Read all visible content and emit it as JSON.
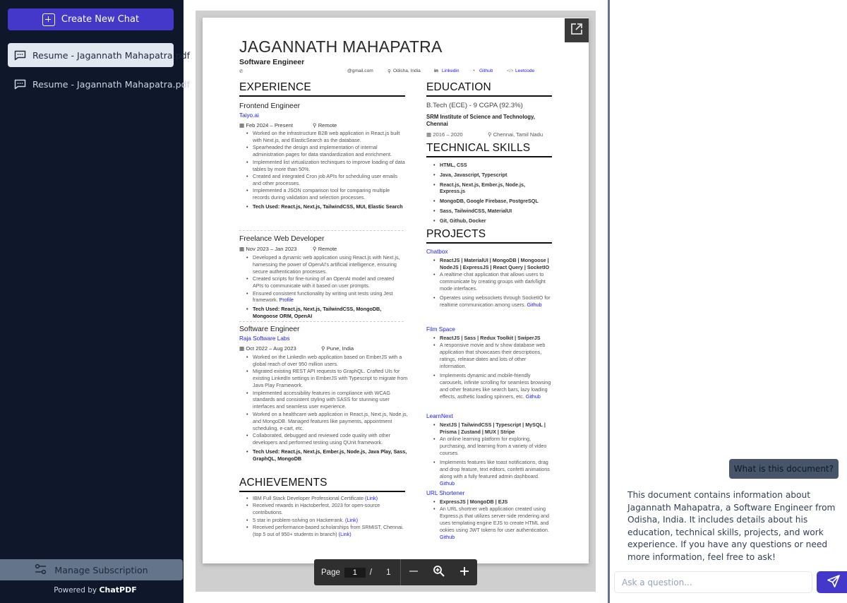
{
  "sidebar": {
    "create_new_chat": "Create New Chat",
    "chats": [
      {
        "label": "Resume - Jagannath Mahapatra.pdf",
        "active": true
      },
      {
        "label": "Resume - Jagannath Mahapatra.pdf",
        "active": false
      }
    ],
    "manage_subscription": "Manage Subscription",
    "powered_prefix": "Powered by",
    "powered_brand": "ChatPDF"
  },
  "colors": {
    "sidebar_bg": "#0f172a",
    "accent": "#4338ca",
    "active_item": "#e2e8f0",
    "slate": "#64748b",
    "link_blue": "#1a1aff"
  },
  "viewer": {
    "toolbar": {
      "page_label": "Page",
      "current_page": "1",
      "separator": "/",
      "total_pages": "1"
    }
  },
  "resume": {
    "name": "JAGANNATH MAHAPATRA",
    "title": "Software Engineer",
    "contact": {
      "phone_icon": "phone-icon",
      "email": "@gmail.com",
      "location": "Odisha, India",
      "linkedin": "Linkedin",
      "github": "Github",
      "leetcode": "Leetcode"
    },
    "sections": {
      "experience": "EXPERIENCE",
      "education": "EDUCATION",
      "skills": "TECHNICAL SKILLS",
      "projects": "PROJECTS",
      "achievements": "ACHIEVEMENTS"
    },
    "experience": [
      {
        "role": "Frontend Engineer",
        "company": "Taiyo.ai",
        "dates": "Feb 2024 – Present",
        "location": "Remote",
        "bullets": [
          "Worked on the infrastructure B2B web application in React.js built with Next.js, and ElasticSearch as the database.",
          "Spearheaded the design and implementation of internal administration pages for data standardization and enrichment.",
          "Implemented list virtualization techinques to improve loading of data tables by more than 50%.",
          "Created and integrated Cron job APIs for scheduling user emails and other processes.",
          "Implemented a JSON comparison tool for comparing multiple records during validation and selection processes."
        ],
        "tech": "Tech Used: React.js, Next.js, TailwindCSS, MUI, Elastic Search"
      },
      {
        "role": "Freelance Web Developer",
        "company": "",
        "dates": "Nov 2023 – Jan 2023",
        "location": "Remote",
        "bullets": [
          "Developed a dynamic web application using React.js with Next.js, harnessing the power of OpenAI's artificial intelligence, ensuring secure authentication processes.",
          "Created scripts for fine-tuning of an OpenAI model and created APIs to communicate with it based on user prompts.",
          "Ensured consistent functionality by writing unit tests using Jest framework."
        ],
        "bullet_link": "Profile",
        "tech": "Tech Used: React.js, Next.js, TailwindCSS, MongoDB, Mongoose ORM, OpenAI"
      },
      {
        "role": "Software Engineer",
        "company": "Raja Software Labs",
        "dates": "Oct 2022 – Aug 2023",
        "location": "Pune, India",
        "bullets": [
          "Worked on the LinkedIn web application based on EmberJS with a global reach of over 950 million users.",
          "Migrated existing REST API requests to GraphQL. Crafted UIs for existing LinkedIn settings in EmberJS with Typescript to migrate from Java Play Framework.",
          "Implemented accessibility features in compliance with WCAG standards and consistent styling with SASS for stunning user interfaces and seamless user experience.",
          "Worked on a healthcare web application in React.js, Next.js, Node.js, and MongoDB. Managed features like payments, appointment scheduling, e-cart, etc.",
          "Collaborated, debugged and reviewed code quality with other developers and performed testing using QUnit framework."
        ],
        "tech": "Tech Used: React.js, Next.js, Ember.js, Node.js, Java Play, Sass, GraphQL, MongoDB"
      }
    ],
    "achievements": [
      {
        "text": "IBM Full Stack Developer Professional Certificate",
        "link": "(Link)"
      },
      {
        "text": "Received rewards in Hactoberfest, 2023 for open-source contributions.",
        "link": ""
      },
      {
        "text": "5 star in problem-solving on Hackerrank.",
        "link": "(Link)"
      },
      {
        "text": "Received performance-based scholarships from SRMIST, Chennai. (top 5 out of 950+ students in branch)",
        "link": "(Link)"
      }
    ],
    "education": {
      "degree": "B.Tech (ECE) - 9 CGPA (92.3%)",
      "school": "SRM Institute of Science and Technology, Chennai",
      "dates": "2016 – 2020",
      "location": "Chennai, Tamil Nadu"
    },
    "skills": [
      "HTML, CSS",
      "Java, Javascript, Typescript",
      "React.js, Next.js, Ember.js, Node.js, Express.js",
      "MongoDB, Google Firebase, PostgreSQL",
      "Sass, TailwindCSS, MaterialUI",
      "Git, Github, Docker"
    ],
    "projects": [
      {
        "name": "Chatbox",
        "stack": "ReactJS | MaterialUI | MongoDB | Mongoose | NodeJS | ExpressJS | React Query | SocketIO",
        "bullets": [
          "A realtime chat application that allows users to communicate by creating groups with dark/light mode interfaces.",
          "Operates using websockets through SocketIO for realtime communication among users."
        ],
        "link": "Github"
      },
      {
        "name": "Film Space",
        "stack": "ReactJS | Sass | Redux Toolkit | SwiperJS",
        "bullets": [
          "A responsive movie and tv show database web application that showcases their descriptions, ratings, release dates and lots of other information.",
          "Implements dynamic and mobile-friendly carousels, infinite scrolling for seamless browsing and other features like search bars, lazy loading effects, asthetic loading spinners, etc."
        ],
        "link": "Github"
      },
      {
        "name": "LearnNext",
        "stack": "NextJS | TailwindCSS | Typescript | MySQL | Prisma | Zustand | MUX | Stripe",
        "bullets": [
          "An online learning platform for exploring, purchasing, and learning from a variety of video courses.",
          "Implements features like toast notifications, drag and drop feature, text editors, confetti animations along with a fully featured admin dashboard."
        ],
        "link": "Github"
      },
      {
        "name": "URL Shortener",
        "stack": "ExpressJS | MongoDB | EJS",
        "bullets": [
          "An URL shortner web application created using Express.js that utilizes server-side rendering and uses templating engine EJS to create HTML and ookies using JWT tokens for user authentication."
        ],
        "link": "Github"
      }
    ]
  },
  "chat": {
    "messages": [
      {
        "role": "user",
        "text": "What is this document?"
      },
      {
        "role": "assistant",
        "text": "This document contains information about Jagannath Mahapatra, a Software Engineer from Odisha, India. It includes details about his education, technical skills, projects, and work experience. If you have any questions or need more information, feel free to ask!"
      }
    ],
    "input_placeholder": "Ask a question...",
    "input_value": ""
  }
}
